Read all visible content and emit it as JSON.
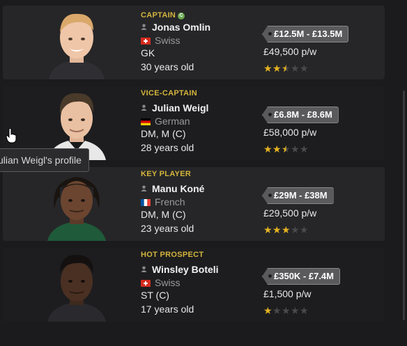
{
  "players": [
    {
      "role": "CAPTAIN",
      "role_badge": "C",
      "name": "Jonas Omlin",
      "nationality": "Swiss",
      "flag": "switzerland",
      "position": "GK",
      "age": "30 years old",
      "value": "£12.5M - £13.5M",
      "wage": "£49,500 p/w",
      "stars": 2.5
    },
    {
      "role": "VICE-CAPTAIN",
      "name": "Julian Weigl",
      "nationality": "German",
      "flag": "germany",
      "position": "DM, M (C)",
      "age": "28 years old",
      "value": "£6.8M - £8.6M",
      "wage": "£58,000 p/w",
      "stars": 2.5
    },
    {
      "role": "KEY PLAYER",
      "name": "Manu Koné",
      "nationality": "French",
      "flag": "france",
      "position": "DM, M (C)",
      "age": "23 years old",
      "value": "£29M - £38M",
      "wage": "£29,500 p/w",
      "stars": 3
    },
    {
      "role": "HOT PROSPECT",
      "name": "Winsley Boteli",
      "nationality": "Swiss",
      "flag": "switzerland",
      "position": "ST (C)",
      "age": "17 years old",
      "value": "£350K - £7.4M",
      "wage": "£1,500 p/w",
      "stars": 1
    }
  ],
  "tooltip": {
    "text": "ulian Weigl's profile"
  },
  "colors": {
    "accent": "#d4b53c",
    "star": "#e6b422",
    "background": "#1b1b1d"
  }
}
